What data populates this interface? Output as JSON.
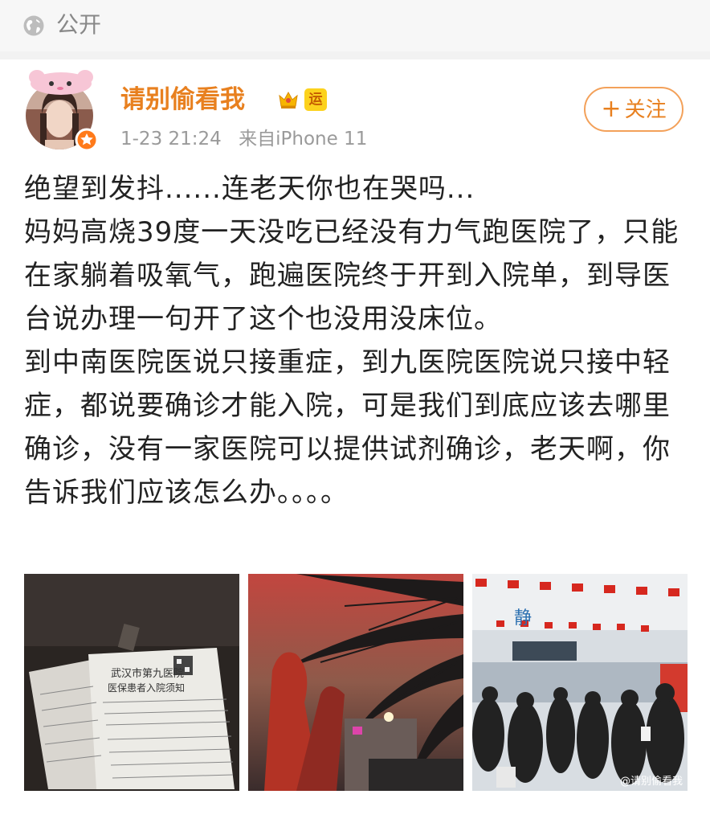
{
  "header": {
    "visibility_label": "公开"
  },
  "author": {
    "name": "请别偷看我",
    "badge_text": "运"
  },
  "meta": {
    "time": "1-23 21:24",
    "source": "来自iPhone 11"
  },
  "follow": {
    "plus": "+",
    "label": "关注"
  },
  "post": {
    "paragraphs": [
      "绝望到发抖......连老天你也在哭吗...",
      "妈妈高烧39度一天没吃已经没有力气跑医院了，只能在家躺着吸氧气，跑遍医院终于开到入院单，到导医台说办理一句开了这个也没用没床位。",
      "到中南医院医说只接重症，到九医院医院说只接中轻症，都说要确诊才能入院，可是我们到底应该去哪里确诊，没有一家医院可以提供试剂确诊，老天啊，你告诉我们应该怎么办。。。。"
    ]
  },
  "images": {
    "img1_text": [
      "武汉市第九医院",
      "医保患者入院须知"
    ],
    "img3_sign": "静",
    "img3_watermark": "@请别偷看我"
  },
  "colors": {
    "accent": "#e8801f",
    "meta": "#9a9a9a"
  }
}
